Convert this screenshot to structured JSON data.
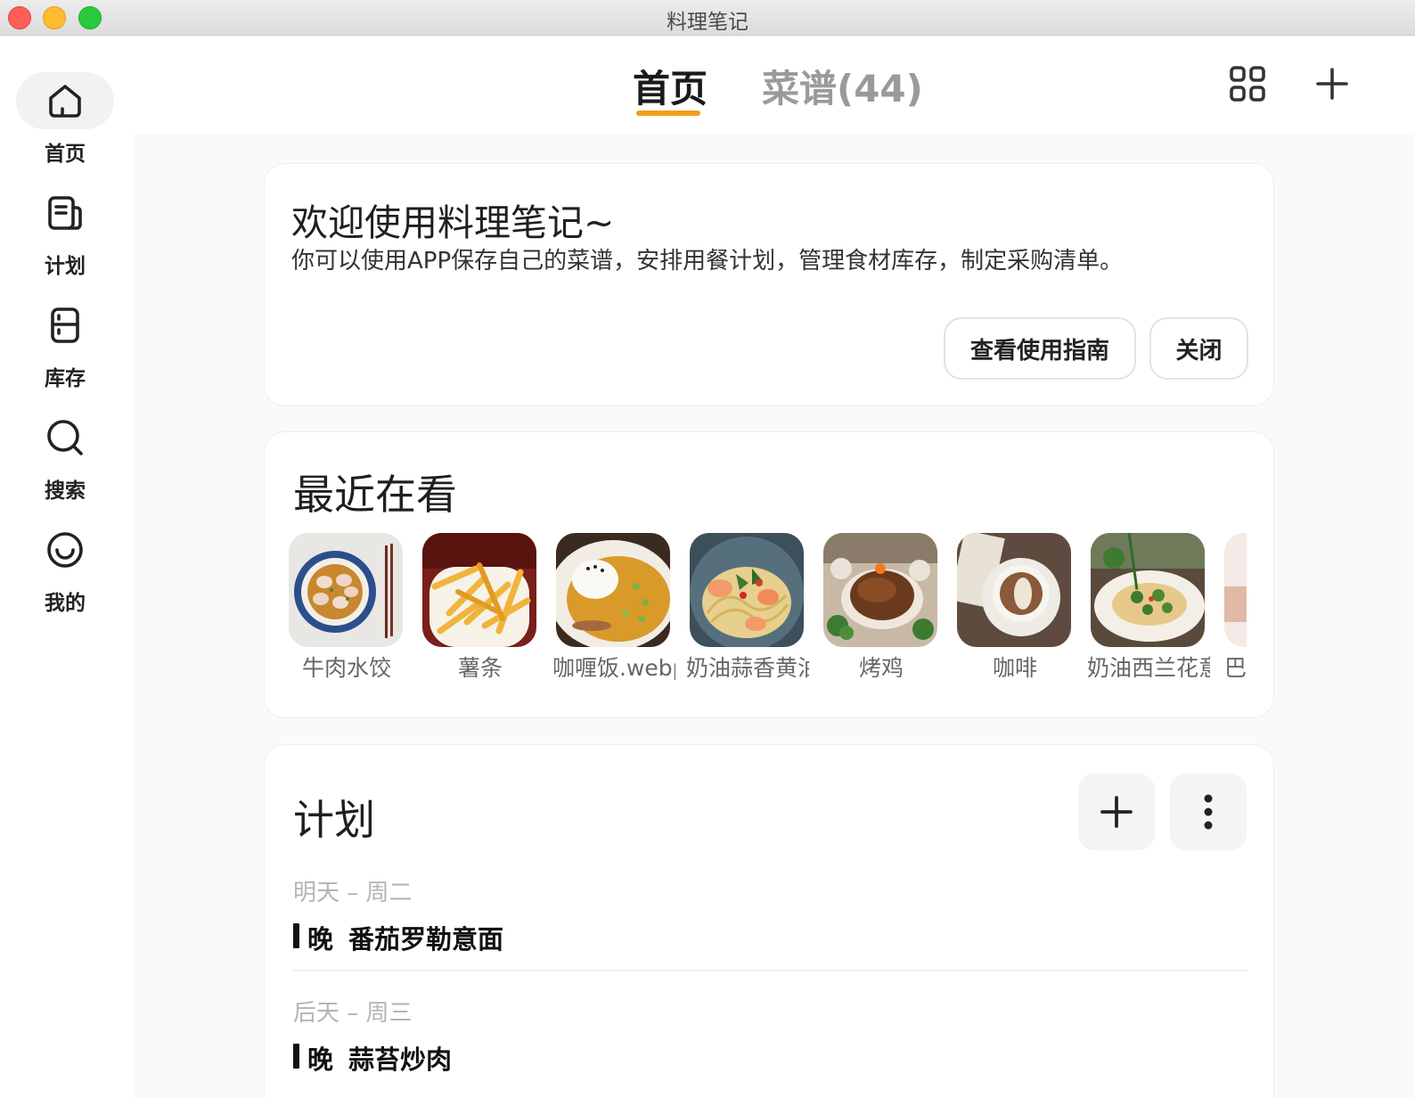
{
  "window": {
    "title": "料理笔记"
  },
  "sidebar": {
    "items": [
      {
        "label": "首页",
        "icon": "home-icon",
        "active": true
      },
      {
        "label": "计划",
        "icon": "plan-icon",
        "active": false
      },
      {
        "label": "库存",
        "icon": "fridge-icon",
        "active": false
      },
      {
        "label": "搜索",
        "icon": "search-icon",
        "active": false
      },
      {
        "label": "我的",
        "icon": "smile-icon",
        "active": false
      }
    ]
  },
  "tabs": [
    {
      "label": "首页",
      "active": true
    },
    {
      "label": "菜谱(44)",
      "active": false
    }
  ],
  "accent_color": "#f0a019",
  "welcome": {
    "title": "欢迎使用料理笔记~",
    "description": "你可以使用APP保存自己的菜谱，安排用餐计划，管理食材库存，制定采购清单。",
    "guide_button": "查看使用指南",
    "close_button": "关闭"
  },
  "recent": {
    "title": "最近在看",
    "items": [
      {
        "label": "牛肉水饺"
      },
      {
        "label": "薯条"
      },
      {
        "label": "咖喱饭.webp"
      },
      {
        "label": "奶油蒜香黄油虾意面"
      },
      {
        "label": "烤鸡"
      },
      {
        "label": "咖啡"
      },
      {
        "label": "奶油西兰花意面"
      },
      {
        "label": "巴"
      }
    ]
  },
  "plan": {
    "title": "计划",
    "days": [
      {
        "header": "明天 – 周二",
        "meal_time": "晚",
        "meal_name": "番茄罗勒意面"
      },
      {
        "header": "后天 – 周三",
        "meal_time": "晚",
        "meal_name": "蒜苔炒肉"
      }
    ]
  }
}
